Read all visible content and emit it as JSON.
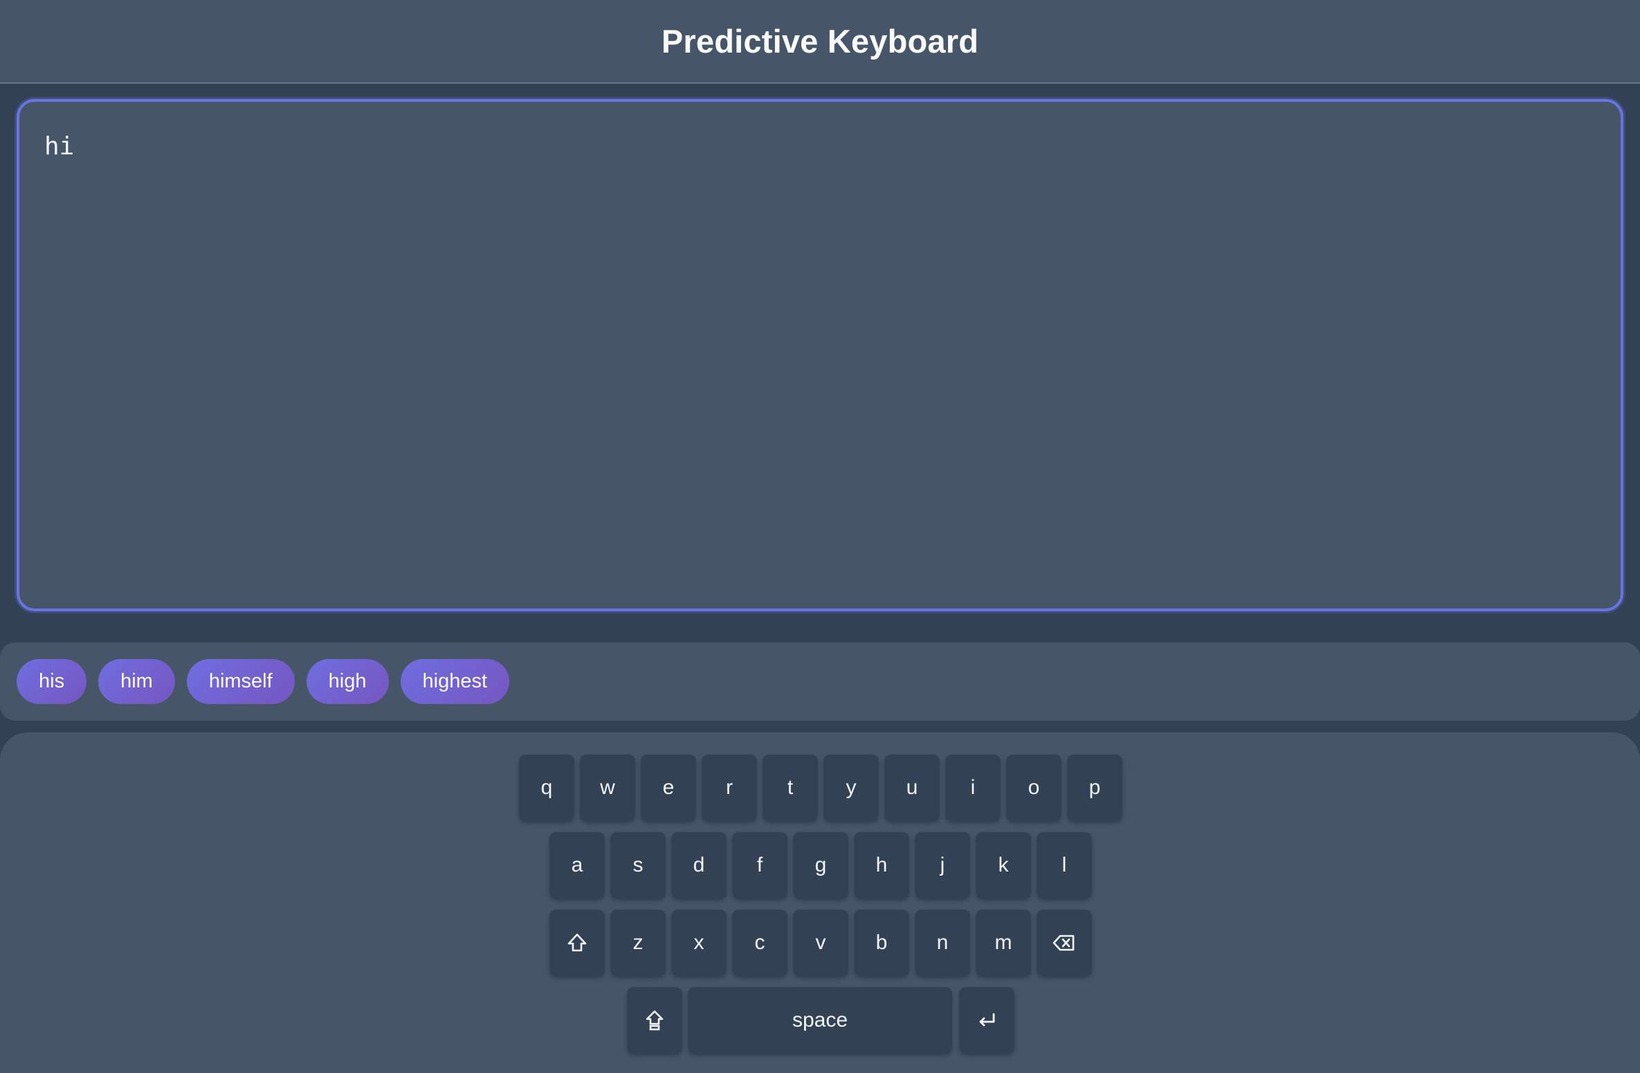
{
  "header": {
    "title": "Predictive Keyboard"
  },
  "editor": {
    "text": "hi"
  },
  "suggestions": [
    "his",
    "him",
    "himself",
    "high",
    "highest"
  ],
  "keyboard": {
    "row1": [
      "q",
      "w",
      "e",
      "r",
      "t",
      "y",
      "u",
      "i",
      "o",
      "p"
    ],
    "row2": [
      "a",
      "s",
      "d",
      "f",
      "g",
      "h",
      "j",
      "k",
      "l"
    ],
    "row3": [
      "z",
      "x",
      "c",
      "v",
      "b",
      "n",
      "m"
    ],
    "space_label": "space",
    "icons": {
      "shift": "shift-icon",
      "backspace": "backspace-icon",
      "caps_lock": "caps-lock-icon",
      "enter": "enter-icon"
    }
  },
  "colors": {
    "background": "#334155",
    "panel": "#475569",
    "key": "#334155",
    "accent": "#6874e0",
    "chip_start": "#6f6ee0",
    "chip_end": "#7656c0",
    "text": "#f1f5f9"
  }
}
